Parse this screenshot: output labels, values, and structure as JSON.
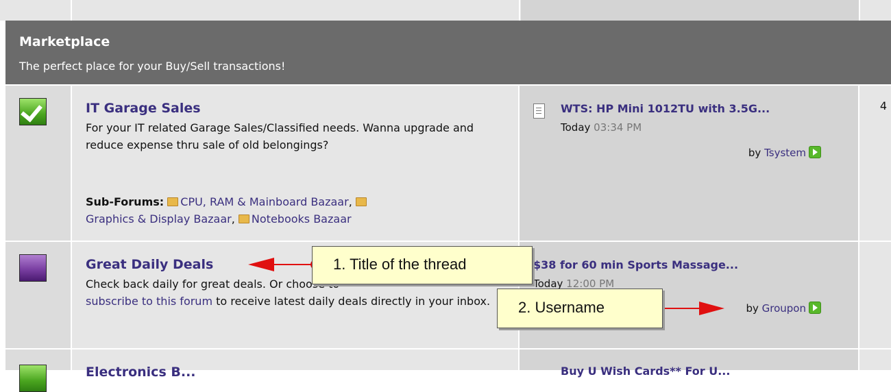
{
  "category": {
    "title": "Marketplace",
    "description": "The perfect place for your Buy/Sell transactions!"
  },
  "forums": [
    {
      "title": "IT Garage Sales",
      "description": "For your IT related Garage Sales/Classified needs. Wanna upgrade and reduce expense thru sale of old belongings?",
      "status_icon": "new-posts-check-icon",
      "subforums_label": "Sub-Forums",
      "subforums": [
        "CPU, RAM & Mainboard Bazaar",
        "Graphics & Display Bazaar",
        "Notebooks Bazaar"
      ],
      "last_post": {
        "title": "WTS: HP Mini 1012TU with 3.5G...",
        "date": "Today",
        "time": "03:34 PM",
        "by_label": "by",
        "user": "Tsystem"
      },
      "stat_peek": "4"
    },
    {
      "title": "Great Daily Deals",
      "description_before": "Check back daily for great deals. Or choose to",
      "description_link": "subscribe to this forum",
      "description_after": "to receive latest daily deals directly in your inbox.",
      "status_icon": "no-new-posts-icon",
      "last_post": {
        "title": "$38 for 60 min Sports Massage...",
        "date": "Today",
        "time": "12:00 PM",
        "by_label": "by",
        "user": "Groupon"
      }
    },
    {
      "title": "Electronics B...",
      "last_post_title": "Buy U Wish Cards** For U..."
    }
  ],
  "annotations": [
    {
      "label": "1. Title of the thread"
    },
    {
      "label": "2. Username"
    }
  ],
  "colors": {
    "header_bg": "#6b6b6b",
    "link": "#3a2f7f",
    "callout_bg": "#ffffcc",
    "arrow": "#e01010"
  }
}
